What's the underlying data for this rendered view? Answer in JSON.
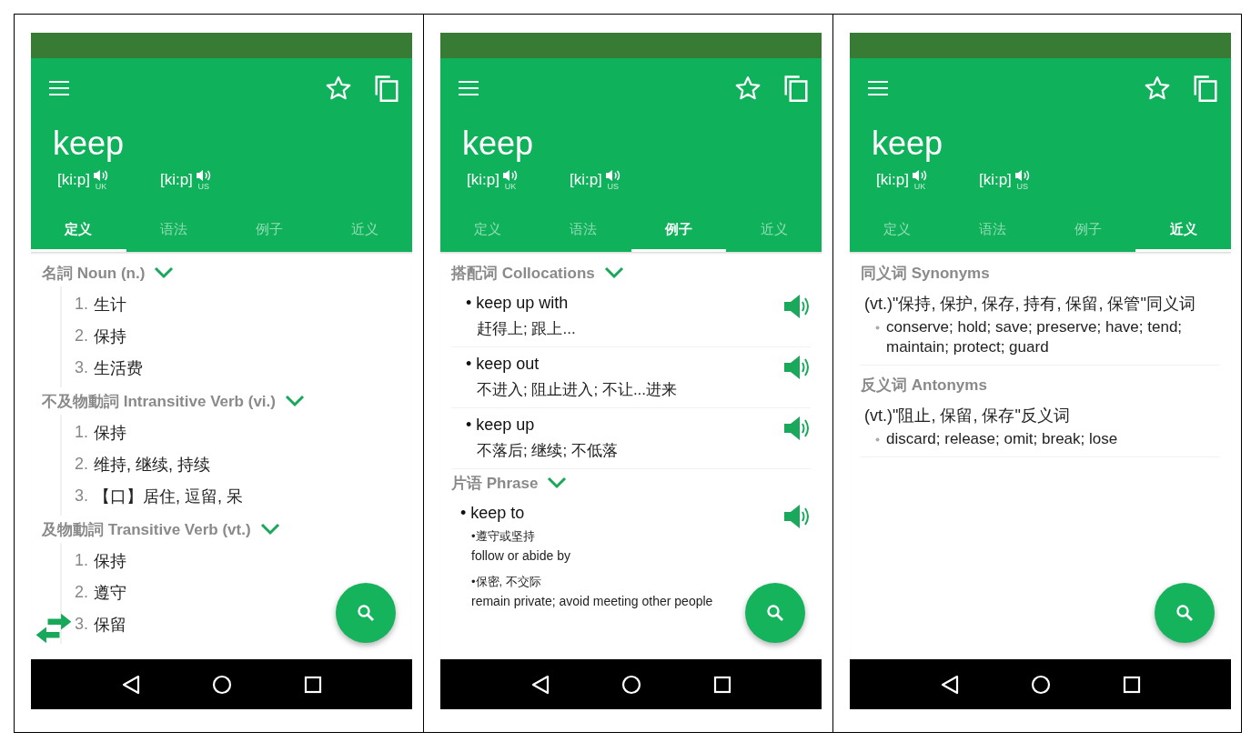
{
  "screens": [
    {
      "kind": "definitions",
      "word": "keep",
      "swap_overlay": true,
      "pronunciations": [
        {
          "ipa": "[ki:p]",
          "region": "UK"
        },
        {
          "ipa": "[ki:p]",
          "region": "US"
        }
      ],
      "tabs": [
        {
          "label": "定义",
          "selected": true
        },
        {
          "label": "语法",
          "selected": false
        },
        {
          "label": "例子",
          "selected": false
        },
        {
          "label": "近义",
          "selected": false
        }
      ],
      "sections": [
        {
          "title": "名詞 Noun (n.)",
          "expanded": true,
          "senses": [
            {
              "number": "1.",
              "text": "生计"
            },
            {
              "number": "2.",
              "text": "保持"
            },
            {
              "number": "3.",
              "text": "生活费"
            }
          ]
        },
        {
          "title": "不及物動詞 Intransitive Verb (vi.)",
          "expanded": true,
          "senses": [
            {
              "number": "1.",
              "text": "保持"
            },
            {
              "number": "2.",
              "text": "维持, 继续, 持续"
            },
            {
              "number": "3.",
              "text": "【口】居住, 逗留, 呆"
            }
          ]
        },
        {
          "title": "及物動詞 Transitive Verb (vt.)",
          "expanded": true,
          "senses": [
            {
              "number": "1.",
              "text": "保持"
            },
            {
              "number": "2.",
              "text": "遵守"
            },
            {
              "number": "3.",
              "text": "保留"
            }
          ]
        }
      ]
    },
    {
      "kind": "examples",
      "word": "keep",
      "swap_overlay": false,
      "pronunciations": [
        {
          "ipa": "[ki:p]",
          "region": "UK"
        },
        {
          "ipa": "[ki:p]",
          "region": "US"
        }
      ],
      "tabs": [
        {
          "label": "定义",
          "selected": false
        },
        {
          "label": "语法",
          "selected": false
        },
        {
          "label": "例子",
          "selected": true
        },
        {
          "label": "近义",
          "selected": false
        }
      ],
      "sections": [
        {
          "title": "搭配词 Collocations",
          "expanded": true,
          "entries": [
            {
              "kind": "collocation",
              "phrase": "• keep up with",
              "meaning": "赶得上; 跟上..."
            },
            {
              "kind": "collocation",
              "phrase": "• keep out",
              "meaning": "不进入; 阻止进入; 不让...进来"
            },
            {
              "kind": "collocation",
              "phrase": "• keep up",
              "meaning": "不落后; 继续; 不低落"
            }
          ]
        },
        {
          "title": "片语 Phrase",
          "expanded": true,
          "entries": [
            {
              "kind": "phrase",
              "phrase": "• keep to",
              "senses": [
                {
                  "zh": "•遵守或坚持",
                  "en": "follow or abide by"
                },
                {
                  "zh": "•保密, 不交际",
                  "en": "remain private; avoid meeting other people"
                }
              ]
            }
          ]
        }
      ]
    },
    {
      "kind": "related",
      "word": "keep",
      "swap_overlay": false,
      "pronunciations": [
        {
          "ipa": "[ki:p]",
          "region": "UK"
        },
        {
          "ipa": "[ki:p]",
          "region": "US"
        }
      ],
      "tabs": [
        {
          "label": "定义",
          "selected": false
        },
        {
          "label": "语法",
          "selected": false
        },
        {
          "label": "例子",
          "selected": false
        },
        {
          "label": "近义",
          "selected": true
        }
      ],
      "sections": [
        {
          "title": "同义词 Synonyms",
          "groups": [
            {
              "gloss": "(vt.)\"保持, 保护, 保存, 持有, 保留, 保管\"同义词",
              "words": "conserve; hold; save; preserve; have; tend; maintain; protect; guard"
            }
          ]
        },
        {
          "title": "反义词 Antonyms",
          "groups": [
            {
              "gloss": "(vt.)\"阻止, 保留, 保存\"反义词",
              "words": "discard; release; omit; break; lose"
            }
          ]
        }
      ]
    }
  ]
}
